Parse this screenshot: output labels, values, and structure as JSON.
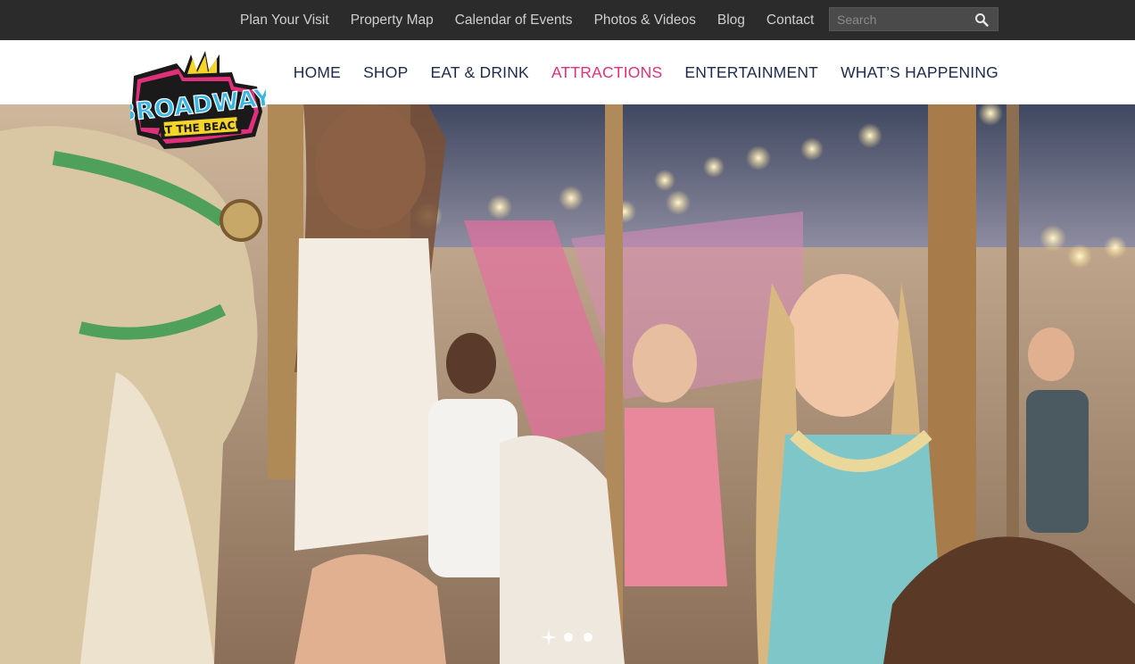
{
  "utility_nav": {
    "links": [
      "Plan Your Visit",
      "Property Map",
      "Calendar of Events",
      "Photos & Videos",
      "Blog",
      "Contact"
    ],
    "search_placeholder": "Search"
  },
  "main_nav": {
    "links": [
      "HOME",
      "SHOP",
      "EAT & DRINK",
      "ATTRACTIONS",
      "ENTERTAINMENT",
      "WHAT’S HAPPENING"
    ],
    "active": "ATTRACTIONS"
  },
  "logo": {
    "line1": "BROADWAY",
    "line2": "AT THE BEACH"
  },
  "hero": {
    "slide_count": 3,
    "current_slide": 1
  },
  "colors": {
    "topbar": "#2b2b2b",
    "nav_text": "#1d2a4a",
    "nav_active": "#e0307a",
    "logo_blue": "#39b6e6",
    "logo_pink": "#e0307a",
    "logo_yellow": "#f5d52a"
  },
  "icons": {
    "search": "search-icon",
    "slide_indicator": "sparkle-icon"
  }
}
